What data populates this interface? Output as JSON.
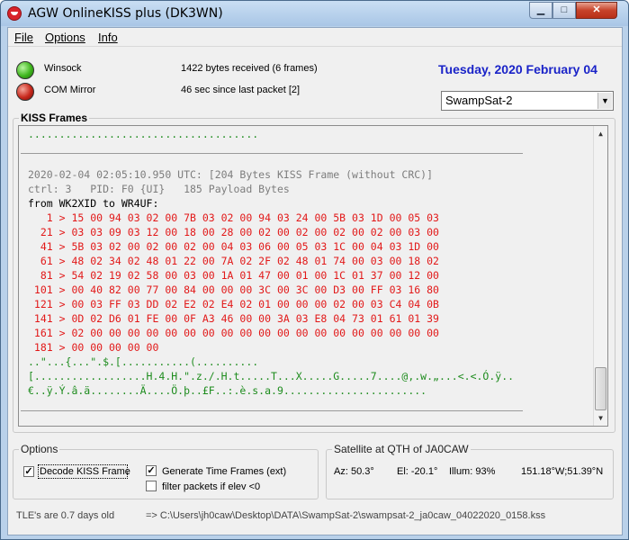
{
  "window": {
    "title": "AGW OnlineKISS plus (DK3WN)",
    "controls": {
      "minimize": "▁",
      "maximize": "□",
      "close": "✕"
    }
  },
  "menu": {
    "file": "File",
    "options": "Options",
    "info": "Info"
  },
  "status": {
    "winsock_label": "Winsock",
    "winsock_state": "green",
    "com_label": "COM Mirror",
    "com_state": "red",
    "bytes_received": "1422 bytes received (6 frames)",
    "last_packet": "46 sec since last packet [2]",
    "date": "Tuesday, 2020 February 04"
  },
  "satellite_select": {
    "selected": "SwampSat-2"
  },
  "kiss_frames": {
    "title": "KISS Frames",
    "top_dots": ".....................................",
    "header_line": "2020-02-04 02:05:10.950 UTC: [204 Bytes KISS Frame (without CRC)]",
    "ctrl_line": "ctrl: 3   PID: F0 {UI}   185 Payload Bytes",
    "from_line": "from WK2XID to WR4UF:",
    "hex_rows": [
      "   1 > 15 00 94 03 02 00 7B 03 02 00 94 03 24 00 5B 03 1D 00 05 03",
      "  21 > 03 03 09 03 12 00 18 00 28 00 02 00 02 00 02 00 02 00 03 00",
      "  41 > 5B 03 02 00 02 00 02 00 04 03 06 00 05 03 1C 00 04 03 1D 00",
      "  61 > 48 02 34 02 48 01 22 00 7A 02 2F 02 48 01 74 00 03 00 18 02",
      "  81 > 54 02 19 02 58 00 03 00 1A 01 47 00 01 00 1C 01 37 00 12 00",
      " 101 > 00 40 82 00 77 00 84 00 00 00 3C 00 3C 00 D3 00 FF 03 16 80",
      " 121 > 00 03 FF 03 DD 02 E2 02 E4 02 01 00 00 00 02 00 03 C4 04 0B",
      " 141 > 0D 02 D6 01 FE 00 0F A3 46 00 00 3A 03 E8 04 73 01 61 01 39",
      " 161 > 02 00 00 00 00 00 00 00 00 00 00 00 00 00 00 00 00 00 00 00",
      " 181 > 00 00 00 00 00"
    ],
    "ascii_rows": [
      "..\"...{...\".$.[...........(..........",
      "[..................H.4.H.\".z./.H.t.....T...X.....G.....7....@,.w.„...<.<.Ó.ÿ..",
      "€..ÿ.Ý.â.ä........Ä....Ö.þ..£F..:.è.s.a.9......................."
    ]
  },
  "options": {
    "title": "Options",
    "decode_kiss": {
      "label": "Decode KISS Frame",
      "checked": true
    },
    "generate_time": {
      "label": "Generate Time Frames (ext)",
      "checked": true
    },
    "filter_packets": {
      "label": "filter packets if elev <0",
      "checked": false
    }
  },
  "satellite_qth": {
    "title": "Satellite at QTH of JA0CAW",
    "az": "Az: 50.3°",
    "el": "El:  -20.1°",
    "illum": "Illum: 93%",
    "position": "151.18°W;51.39°N"
  },
  "footer": {
    "tle_age": "TLE's are 0.7 days old",
    "output_path": "=> C:\\Users\\jh0caw\\Desktop\\DATA\\SwampSat-2\\swampsat-2_ja0caw_04022020_0158.kss"
  }
}
